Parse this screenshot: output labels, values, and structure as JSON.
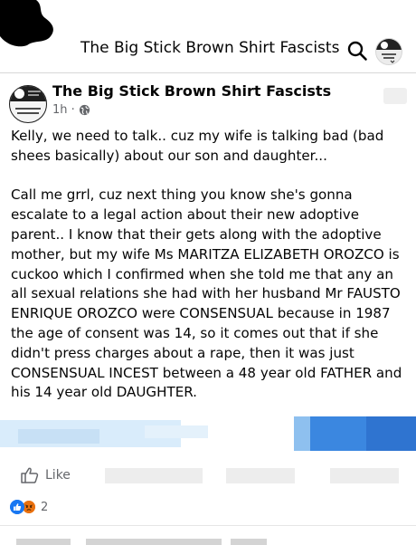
{
  "header": {
    "title": "The Big Stick Brown Shirt Fascists",
    "search_icon": "search-icon",
    "avatar_icon": "group-avatar"
  },
  "post": {
    "author": "The Big Stick Brown Shirt Fascists",
    "time": "1h",
    "separator": "·",
    "privacy_icon": "globe-icon",
    "text": "Kelly, we need to talk.. cuz my wife is talking bad (bad shees basically) about our son and daughter...\n\nCall me grrl, cuz next thing you know she's gonna escalate to a legal action about their new adoptive parent.. I know that their gets along with the adoptive mother, but my wife Ms MARITZA ELIZABETH OROZCO is cuckoo which I confirmed when she told me that any an all sexual relations she had with her husband Mr FAUSTO ENRIQUE OROZCO were CONSENSUAL because in 1987 the age of consent was 14, so it comes out that if she didn't press charges about a rape, then it was just CONSENSUAL INCEST between a 48 year old FATHER and his 14 year old DAUGHTER."
  },
  "actions": {
    "like_label": "Like",
    "like_icon": "thumbs-up-icon"
  },
  "reactions": {
    "count": "2",
    "icons": [
      "like-reaction-icon",
      "angry-reaction-icon"
    ]
  },
  "colors": {
    "text": "#050505",
    "secondary": "#65676b",
    "like_blue": "#1877f2",
    "angry_orange": "#e9710f"
  }
}
